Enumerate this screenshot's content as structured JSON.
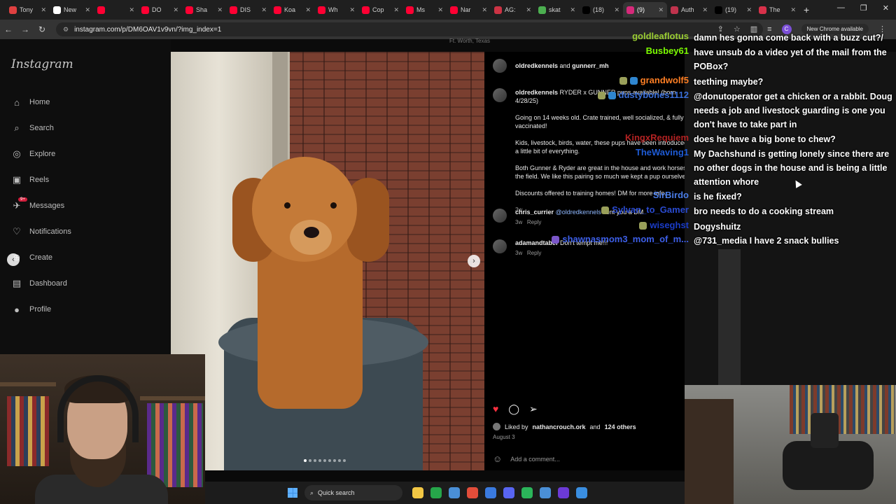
{
  "browser": {
    "tabs": [
      {
        "label": "Tony",
        "color": "#e04040"
      },
      {
        "label": "New",
        "color": "#ffffff"
      },
      {
        "label": "",
        "color": "#ff0033"
      },
      {
        "label": "DO",
        "color": "#ff0033"
      },
      {
        "label": "Sha",
        "color": "#ff0033"
      },
      {
        "label": "DIS",
        "color": "#ff0033"
      },
      {
        "label": "Koa",
        "color": "#ff0033"
      },
      {
        "label": "Wh",
        "color": "#ff0033"
      },
      {
        "label": "Cop",
        "color": "#ff0033"
      },
      {
        "label": "Ms",
        "color": "#ff0033"
      },
      {
        "label": "Nar",
        "color": "#ff0033"
      },
      {
        "label": "AG:",
        "color": "#cc3344"
      },
      {
        "label": "skat",
        "color": "#4caf50"
      },
      {
        "label": "(18)",
        "color": "#000000"
      },
      {
        "label": "(9)",
        "color": "#d6297a"
      },
      {
        "label": "Auth",
        "color": "#c0334d"
      },
      {
        "label": "(19)",
        "color": "#000000"
      },
      {
        "label": "The",
        "color": "#d8314a"
      }
    ],
    "active_tab_index": 14,
    "url": "instagram.com/p/DM6OAV1v9vn/?img_index=1",
    "new_chrome_label": "New Chrome available",
    "profile_initial": "C"
  },
  "instagram": {
    "logo": "Instagram",
    "nav": [
      {
        "label": "Home",
        "icon": "home-icon",
        "glyph": "⌂"
      },
      {
        "label": "Search",
        "icon": "search-icon",
        "glyph": "⌕"
      },
      {
        "label": "Explore",
        "icon": "compass-icon",
        "glyph": "◎"
      },
      {
        "label": "Reels",
        "icon": "reels-icon",
        "glyph": "▣"
      },
      {
        "label": "Messages",
        "icon": "messages-icon",
        "glyph": "✈",
        "badge": "9+"
      },
      {
        "label": "Notifications",
        "icon": "heart-icon",
        "glyph": "♡"
      },
      {
        "label": "Create",
        "icon": "plus-icon",
        "glyph": "⊕"
      },
      {
        "label": "Dashboard",
        "icon": "dashboard-icon",
        "glyph": "▤"
      },
      {
        "label": "Profile",
        "icon": "avatar",
        "glyph": "●"
      }
    ],
    "location": "Ft. Worth, Texas",
    "post": {
      "author": "oldredkennels",
      "connector": "and",
      "coauthor": "gunnerr_mh",
      "caption_lead": "RYDER x GUNNER pups available! (born 4/28/25)",
      "caption_paragraphs": [
        "Going on 14 weeks old. Crate trained, well socialized, & fully vaccinated!",
        "Kids, livestock, birds, water, these pups have been introduced to a little bit of everything.",
        "Both Gunner & Ryder are great in the house and work horses in the field. We like this pairing so much we kept a pup ourselves",
        "Discounts offered to training homes! DM for more info."
      ],
      "caption_age": "3w",
      "comments": [
        {
          "user": "chris_currier",
          "mention": "@oldredkennels",
          "text": "sent you a DM",
          "age": "3w",
          "reply": "Reply"
        },
        {
          "user": "adamandtaber",
          "mention": "",
          "text": "Don't tempt me!!!",
          "age": "3w",
          "reply": "Reply"
        }
      ],
      "liked_by_prefix": "Liked by",
      "liked_by_user": "nathancrouch.ork",
      "liked_by_and": "and",
      "liked_by_others": "124 others",
      "date": "August 3",
      "add_comment_placeholder": "Add a comment...",
      "image_count": 9,
      "image_index": 1
    }
  },
  "chat": [
    {
      "name": "goldleaflotus",
      "color": "#9acd32",
      "msg": "damn hes gonna come back with a buzz cut?/",
      "icons": []
    },
    {
      "name": "Busbey61",
      "color": "#7cfc00",
      "msg": "have unsub do a video yet of the mail from the POBox?",
      "icons": []
    },
    {
      "name": "grandwolf5",
      "color": "#ff7f24",
      "msg": "teething maybe?",
      "icons": [
        "#9aa05a",
        "#2f86d0"
      ]
    },
    {
      "name": "dustybones1112",
      "color": "#3a6fd8",
      "msg": "@donutoperator get a chicken or a rabbit. Doug needs a job and livestock guarding is one you don't have to take part in",
      "icons": [
        "#9aa05a",
        "#2f86d0"
      ]
    },
    {
      "name": "KingxRequiem",
      "color": "#b22222",
      "msg": "does he have a big bone to chew?",
      "icons": []
    },
    {
      "name": "TheWaving1",
      "color": "#1e5bd6",
      "msg": "My Dachshund is getting lonely since there are no other dogs in the house and is being a little attention whore",
      "icons": []
    },
    {
      "name": "SirBirdo",
      "color": "#4a7de8",
      "msg": "is he fixed?",
      "icons": []
    },
    {
      "name": "Sylvan_to_Gamer",
      "color": "#2a4bd0",
      "msg": "bro needs to do a cooking stream",
      "icons": [
        "#9aa05a"
      ]
    },
    {
      "name": "wiseghst",
      "color": "#1a3cc8",
      "msg": "Dogyshuitz",
      "icons": [
        "#9aa05a"
      ]
    },
    {
      "name": "shawnasmom3_mom_of_m...",
      "color": "#3d5fe8",
      "msg": "@731_media I have 2 snack bullies",
      "icons": [
        "#7a56c8"
      ]
    }
  ],
  "taskbar": {
    "search_label": "Quick search",
    "apps": [
      "#f2c744",
      "#26a64a",
      "#4a8fd6",
      "#e24d3a",
      "#3a7ae0",
      "#5865f2",
      "#2bb55a",
      "#4a8fd6",
      "#6c3ad6",
      "#3a8ee0"
    ]
  }
}
